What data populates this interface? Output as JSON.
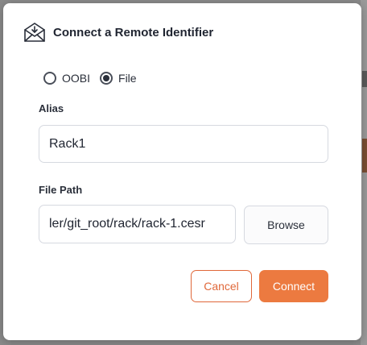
{
  "dialog": {
    "title": "Connect a Remote Identifier",
    "icon": "envelope-download-icon"
  },
  "source": {
    "options": [
      {
        "label": "OOBI",
        "checked": false
      },
      {
        "label": "File",
        "checked": true
      }
    ]
  },
  "alias": {
    "label": "Alias",
    "value": "Rack1"
  },
  "file_path": {
    "label": "File Path",
    "value": "ler/git_root/rack/rack-1.cesr",
    "browse_label": "Browse"
  },
  "actions": {
    "cancel_label": "Cancel",
    "connect_label": "Connect"
  },
  "colors": {
    "accent": "#ec7a40",
    "accent_outline": "#e0683a",
    "text": "#1f2430"
  }
}
